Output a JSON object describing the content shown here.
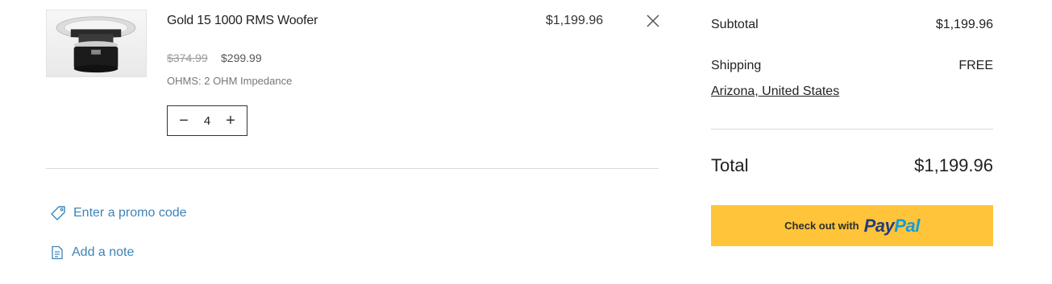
{
  "cart_item": {
    "name": "Gold 15 1000 RMS Woofer",
    "original_price": "$374.99",
    "sale_price": "$299.99",
    "variant": "OHMS: 2 OHM Impedance",
    "quantity": "4",
    "line_total": "$1,199.96",
    "image_icon": "subwoofer-image",
    "remove_icon": "close-icon"
  },
  "links": {
    "promo_label": "Enter a promo code",
    "promo_icon": "tag-icon",
    "note_label": "Add a note",
    "note_icon": "note-icon"
  },
  "summary": {
    "subtotal_label": "Subtotal",
    "subtotal_value": "$1,199.96",
    "shipping_label": "Shipping",
    "shipping_value": "FREE",
    "location": "Arizona, United States",
    "total_label": "Total",
    "total_value": "$1,199.96"
  },
  "checkout": {
    "lead_text": "Check out with",
    "brand_part1": "Pay",
    "brand_part2": "Pal",
    "button_color": "#ffc439",
    "brand_dark": "#253b80",
    "brand_light": "#179bd7"
  },
  "colors": {
    "link": "#3b84b8",
    "divider": "#d9d9d9"
  }
}
